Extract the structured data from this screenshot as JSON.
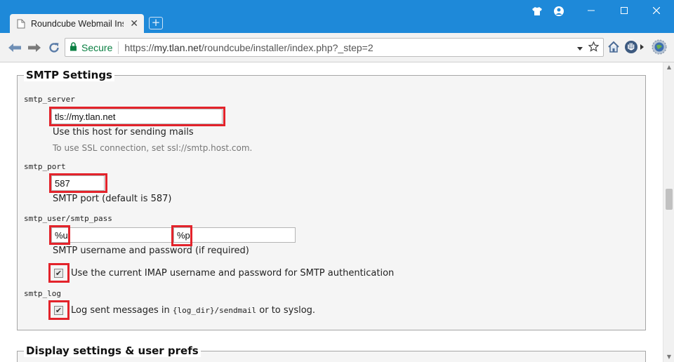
{
  "browser": {
    "tab_title": "Roundcube Webmail Inst",
    "new_tab_label": "+",
    "close_tab_label": "✕",
    "secure_label": "Secure",
    "url_scheme": "https://",
    "url_host": "my.tlan.net",
    "url_path": "/roundcube/installer/index.php?_step=2",
    "accent": "#1e89d9"
  },
  "smtp": {
    "legend": "SMTP Settings",
    "server_label": "smtp_server",
    "server_value": "tls://my.tlan.net",
    "server_hint": "Use this host for sending mails",
    "server_subhint": "To use SSL connection, set ssl://smtp.host.com.",
    "port_label": "smtp_port",
    "port_value": "587",
    "port_hint": "SMTP port (default is 587)",
    "userpass_label": "smtp_user/smtp_pass",
    "user_value": "%u",
    "pass_value": "%p",
    "userpass_hint": "SMTP username and password (if required)",
    "imap_checkbox_checked": true,
    "imap_checkbox_label": "Use the current IMAP username and password for SMTP authentication",
    "log_label": "smtp_log",
    "log_checkbox_checked": true,
    "log_text_before": "Log sent messages in ",
    "log_text_code": "{log_dir}/sendmail",
    "log_text_after": " or to syslog.",
    "highlight_color": "#e3232b"
  },
  "display": {
    "legend": "Display settings & user prefs"
  }
}
